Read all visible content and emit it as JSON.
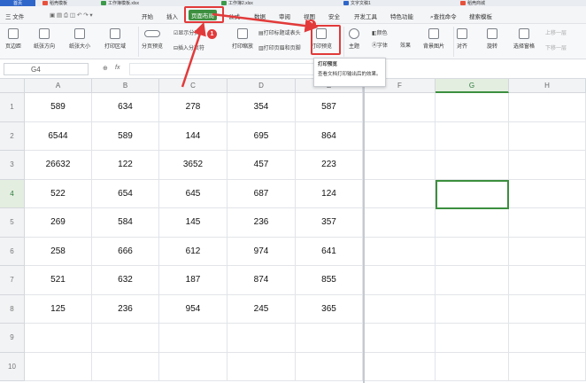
{
  "titlebar": {
    "home_tab": "首页",
    "tabs": [
      "稻壳模板",
      "工作簿模板.xlsx",
      "工作簿2.xlsx",
      "文字文稿1",
      "稻壳商城"
    ]
  },
  "menubar": {
    "file": "三 文件",
    "items": [
      "开始",
      "插入",
      "页面布局",
      "公式",
      "数据",
      "审阅",
      "视图",
      "安全",
      "开发工具",
      "特色功能"
    ],
    "search": "查找命令",
    "search_template": "搜索模板"
  },
  "ribbon": {
    "page_margin": "页边距",
    "orientation": "纸张方向",
    "paper_size": "纸张大小",
    "print_area": "打印区域",
    "page_break_preview": "分页预览",
    "show_breaks": "显示分页符",
    "insert_break": "插入分页符",
    "print_scale": "打印缩放",
    "print_titles": "打印标题或表头",
    "header_footer": "打印页眉和页脚",
    "print_preview": "打印预览",
    "theme": "主题",
    "colors": "颜色",
    "fonts": "字体",
    "effects": "效果",
    "background": "背景图片",
    "align": "对齐",
    "rotate": "旋转",
    "selection_pane": "选择窗格",
    "move_up": "上移一层",
    "move_down": "下移一层"
  },
  "formula_bar": {
    "cell_ref": "G4",
    "fx_label": "fx",
    "zoom_icon": "magnify-icon",
    "value": ""
  },
  "tooltip": {
    "title": "打印预览",
    "body": "查看文档打印输出后的效果。"
  },
  "callouts": [
    "1",
    "2"
  ],
  "columns": [
    "A",
    "B",
    "C",
    "D",
    "E",
    "F",
    "G",
    "H"
  ],
  "rows": [
    "1",
    "2",
    "3",
    "4",
    "5",
    "6",
    "7",
    "8",
    "9",
    "10"
  ],
  "cells": [
    [
      "589",
      "634",
      "278",
      "354",
      "587"
    ],
    [
      "6544",
      "589",
      "144",
      "695",
      "864"
    ],
    [
      "26632",
      "122",
      "3652",
      "457",
      "223"
    ],
    [
      "522",
      "654",
      "645",
      "687",
      "124"
    ],
    [
      "269",
      "584",
      "145",
      "236",
      "357"
    ],
    [
      "258",
      "666",
      "612",
      "974",
      "641"
    ],
    [
      "521",
      "632",
      "187",
      "874",
      "855"
    ],
    [
      "125",
      "236",
      "954",
      "245",
      "365"
    ]
  ],
  "colors": {
    "accent": "#3c8f3f",
    "callout": "#e23a3a"
  }
}
